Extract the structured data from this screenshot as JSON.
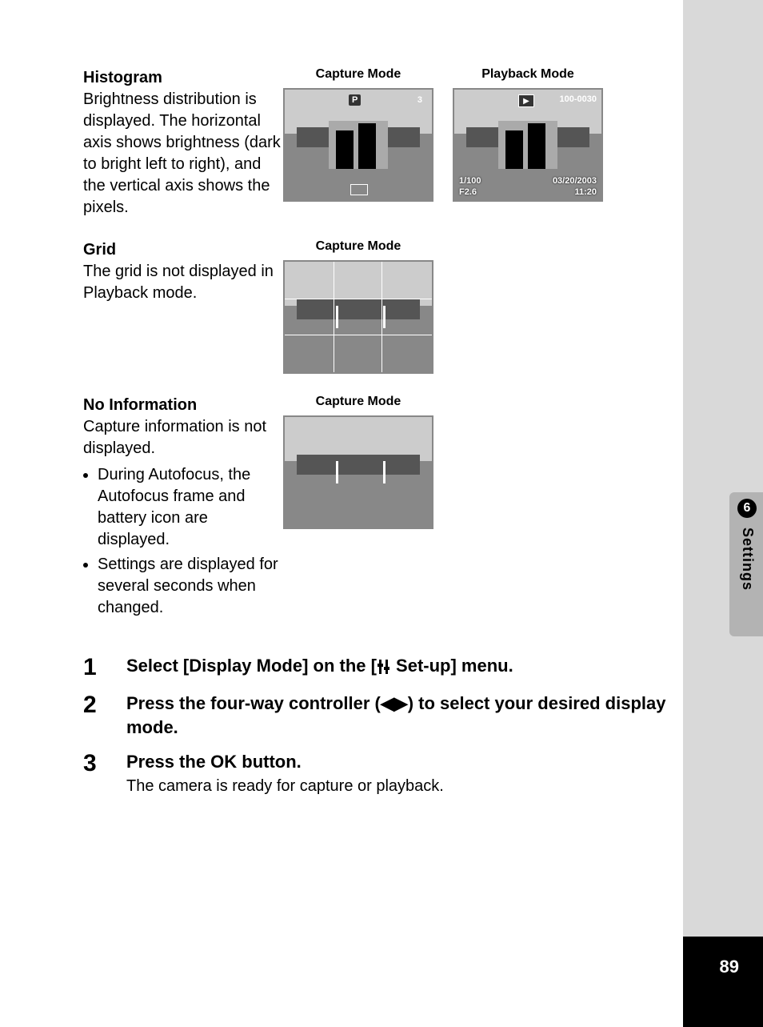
{
  "page_number": "89",
  "side_tab": {
    "chapter_number": "6",
    "label": "Settings"
  },
  "sections": {
    "histogram": {
      "heading": "Histogram",
      "body": "Brightness distribution is displayed. The horizontal axis shows brightness (dark to bright left to right), and the vertical axis shows the pixels.",
      "capture_label": "Capture Mode",
      "playback_label": "Playback Mode",
      "capture_overlay": {
        "mode_badge": "P",
        "shots_remaining": "3"
      },
      "playback_overlay": {
        "folder_file": "100-0030",
        "shutter": "1/100",
        "aperture": "F2.6",
        "date": "03/20/2003",
        "time": "11:20"
      }
    },
    "grid": {
      "heading": "Grid",
      "body": "The grid is not displayed in Playback mode.",
      "capture_label": "Capture Mode"
    },
    "noinfo": {
      "heading": "No Information",
      "body": "Capture information is not displayed.",
      "bullets": [
        "During Autofocus, the Autofocus frame and battery icon are displayed.",
        "Settings are displayed for several seconds when changed."
      ],
      "capture_label": "Capture Mode"
    }
  },
  "steps": [
    {
      "num": "1",
      "title_pre": "Select [Display Mode] on the [",
      "title_post": " Set-up] menu."
    },
    {
      "num": "2",
      "title": "Press the four-way controller (◀▶) to select your desired display mode."
    },
    {
      "num": "3",
      "title": "Press the OK button.",
      "desc": "The camera is ready for capture or playback."
    }
  ]
}
